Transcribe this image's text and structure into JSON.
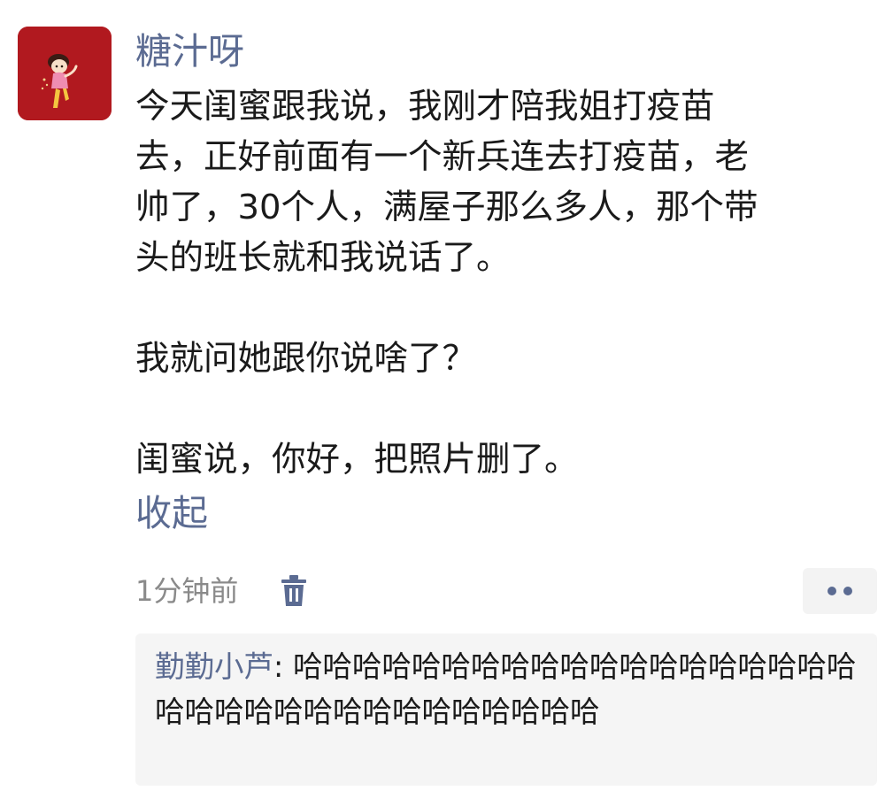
{
  "post": {
    "avatar_icon": "cartoon-girl-avatar",
    "username": "糖汁呀",
    "body": "今天闺蜜跟我说，我刚才陪我姐打疫苗\n去，正好前面有一个新兵连去打疫苗，老\n帅了，30个人，满屋子那么多人，那个带\n头的班长就和我说话了。\n\n我就问她跟你说啥了？\n\n闺蜜说，你好，把照片删了。",
    "collapse_label": "收起",
    "timestamp": "1分钟前",
    "delete_icon": "trash-icon",
    "more_icon": "more-dots-icon"
  },
  "comment": {
    "author": "勤勤小芦",
    "separator": ": ",
    "text": "哈哈哈哈哈哈哈哈哈哈哈哈哈哈哈哈哈哈哈哈哈哈哈哈哈哈哈哈哈哈哈哈哈哈"
  },
  "colors": {
    "link_blue": "#5b6b92",
    "avatar_bg": "#b1191f",
    "text": "#1a1a1a",
    "meta_gray": "#8a8a8a"
  }
}
